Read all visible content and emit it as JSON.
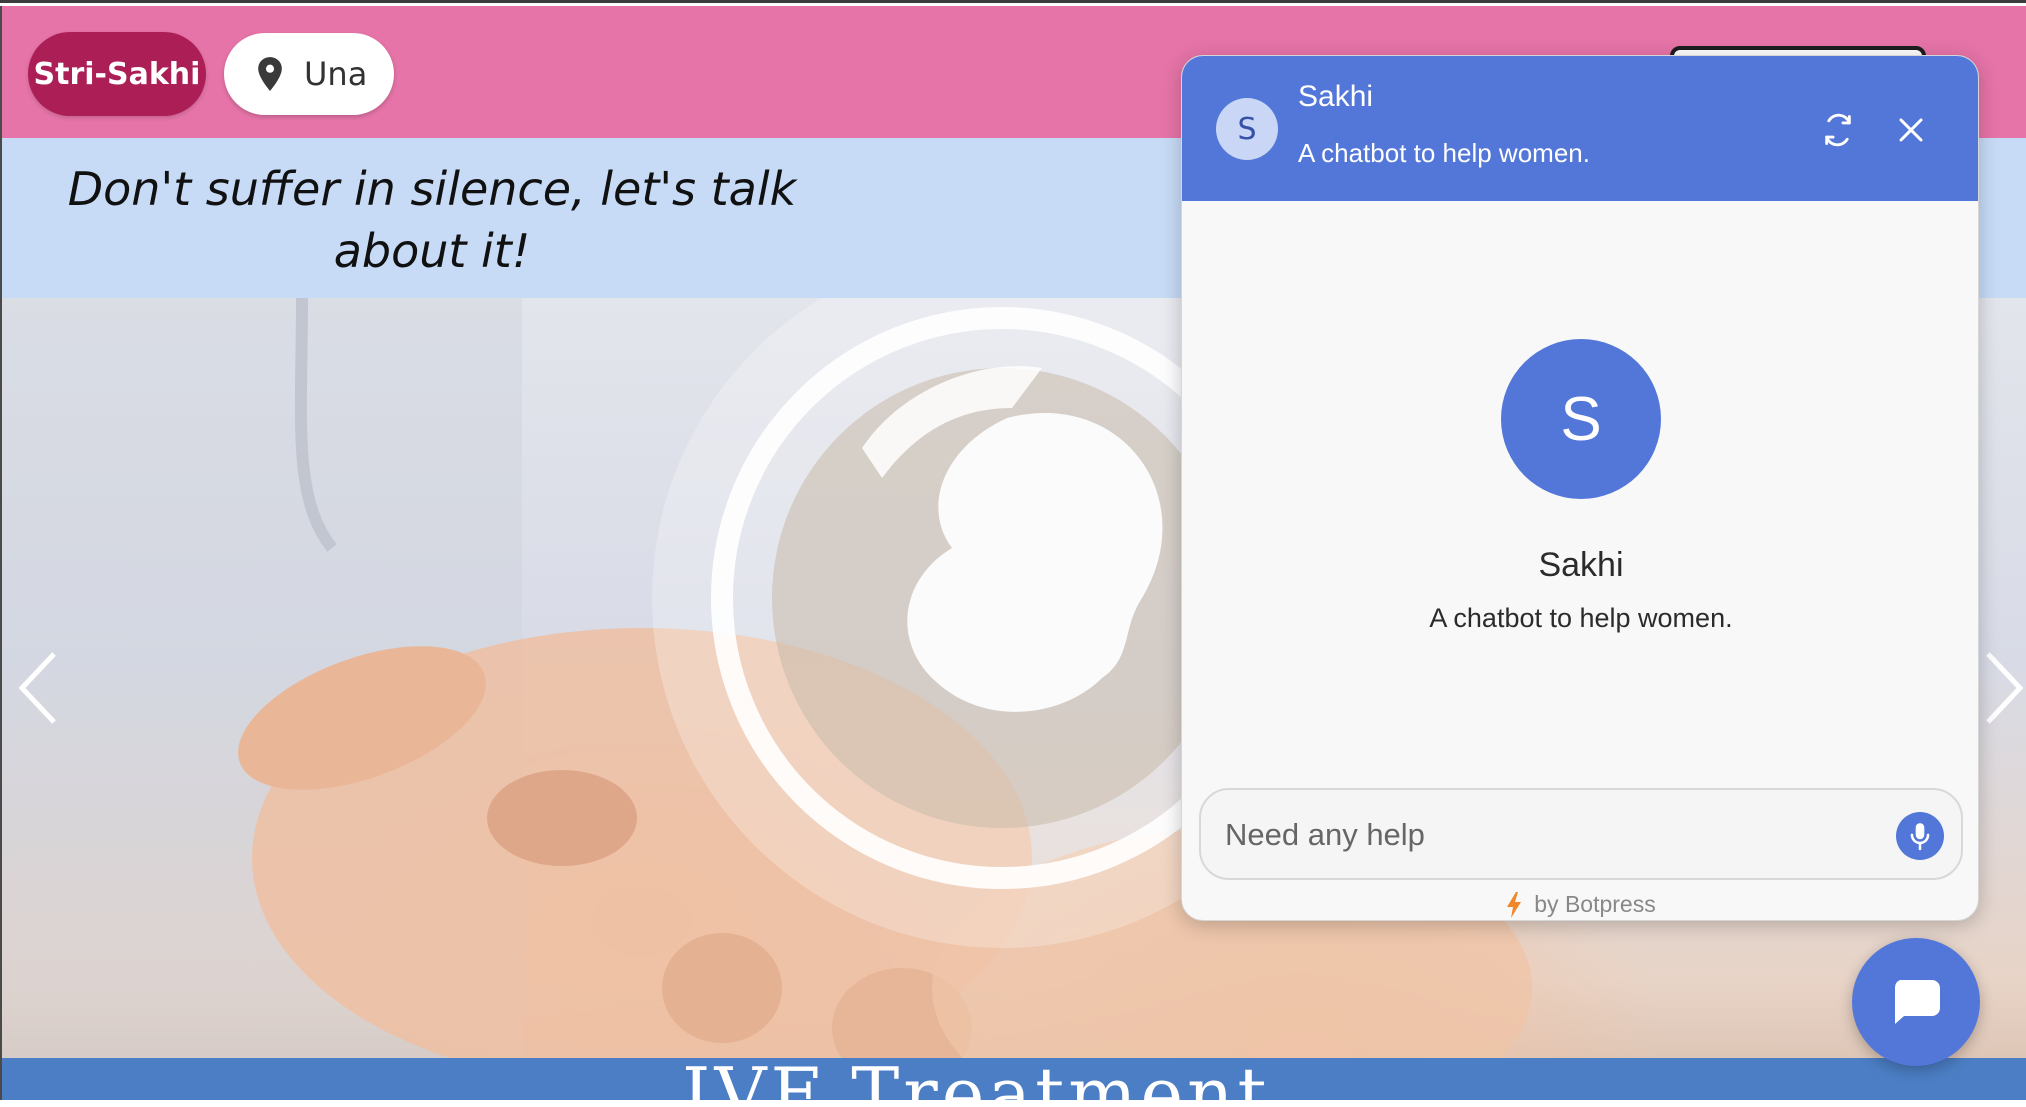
{
  "navbar": {
    "brand": "Stri-Sakhi",
    "location": "Una",
    "icons": {
      "location": "map-pin-icon"
    }
  },
  "tagline": "Don't suffer in silence, let's talk about it!",
  "hero": {
    "banner_text": "IVF Treatment",
    "icons": {
      "prev": "chevron-left-icon",
      "next": "chevron-right-icon"
    }
  },
  "chat": {
    "bot_initial": "S",
    "bot_name": "Sakhi",
    "bot_description": "A chatbot to help women.",
    "composer_placeholder": "Need any help",
    "powered_by": "by Botpress",
    "icons": {
      "refresh": "refresh-icon",
      "close": "close-icon",
      "mic": "microphone-icon",
      "bolt": "lightning-bolt-icon",
      "launcher": "chat-bubble-icon"
    },
    "colors": {
      "header": "#5377d8",
      "avatar_light": "#c9d6f6",
      "bolt": "#f0872a"
    }
  },
  "colors": {
    "navbar_bg": "#e674a8",
    "brand_bg": "#ab1f56",
    "tagline_bg": "#c7dbf6",
    "banner_bg": "#4b7ec4"
  }
}
